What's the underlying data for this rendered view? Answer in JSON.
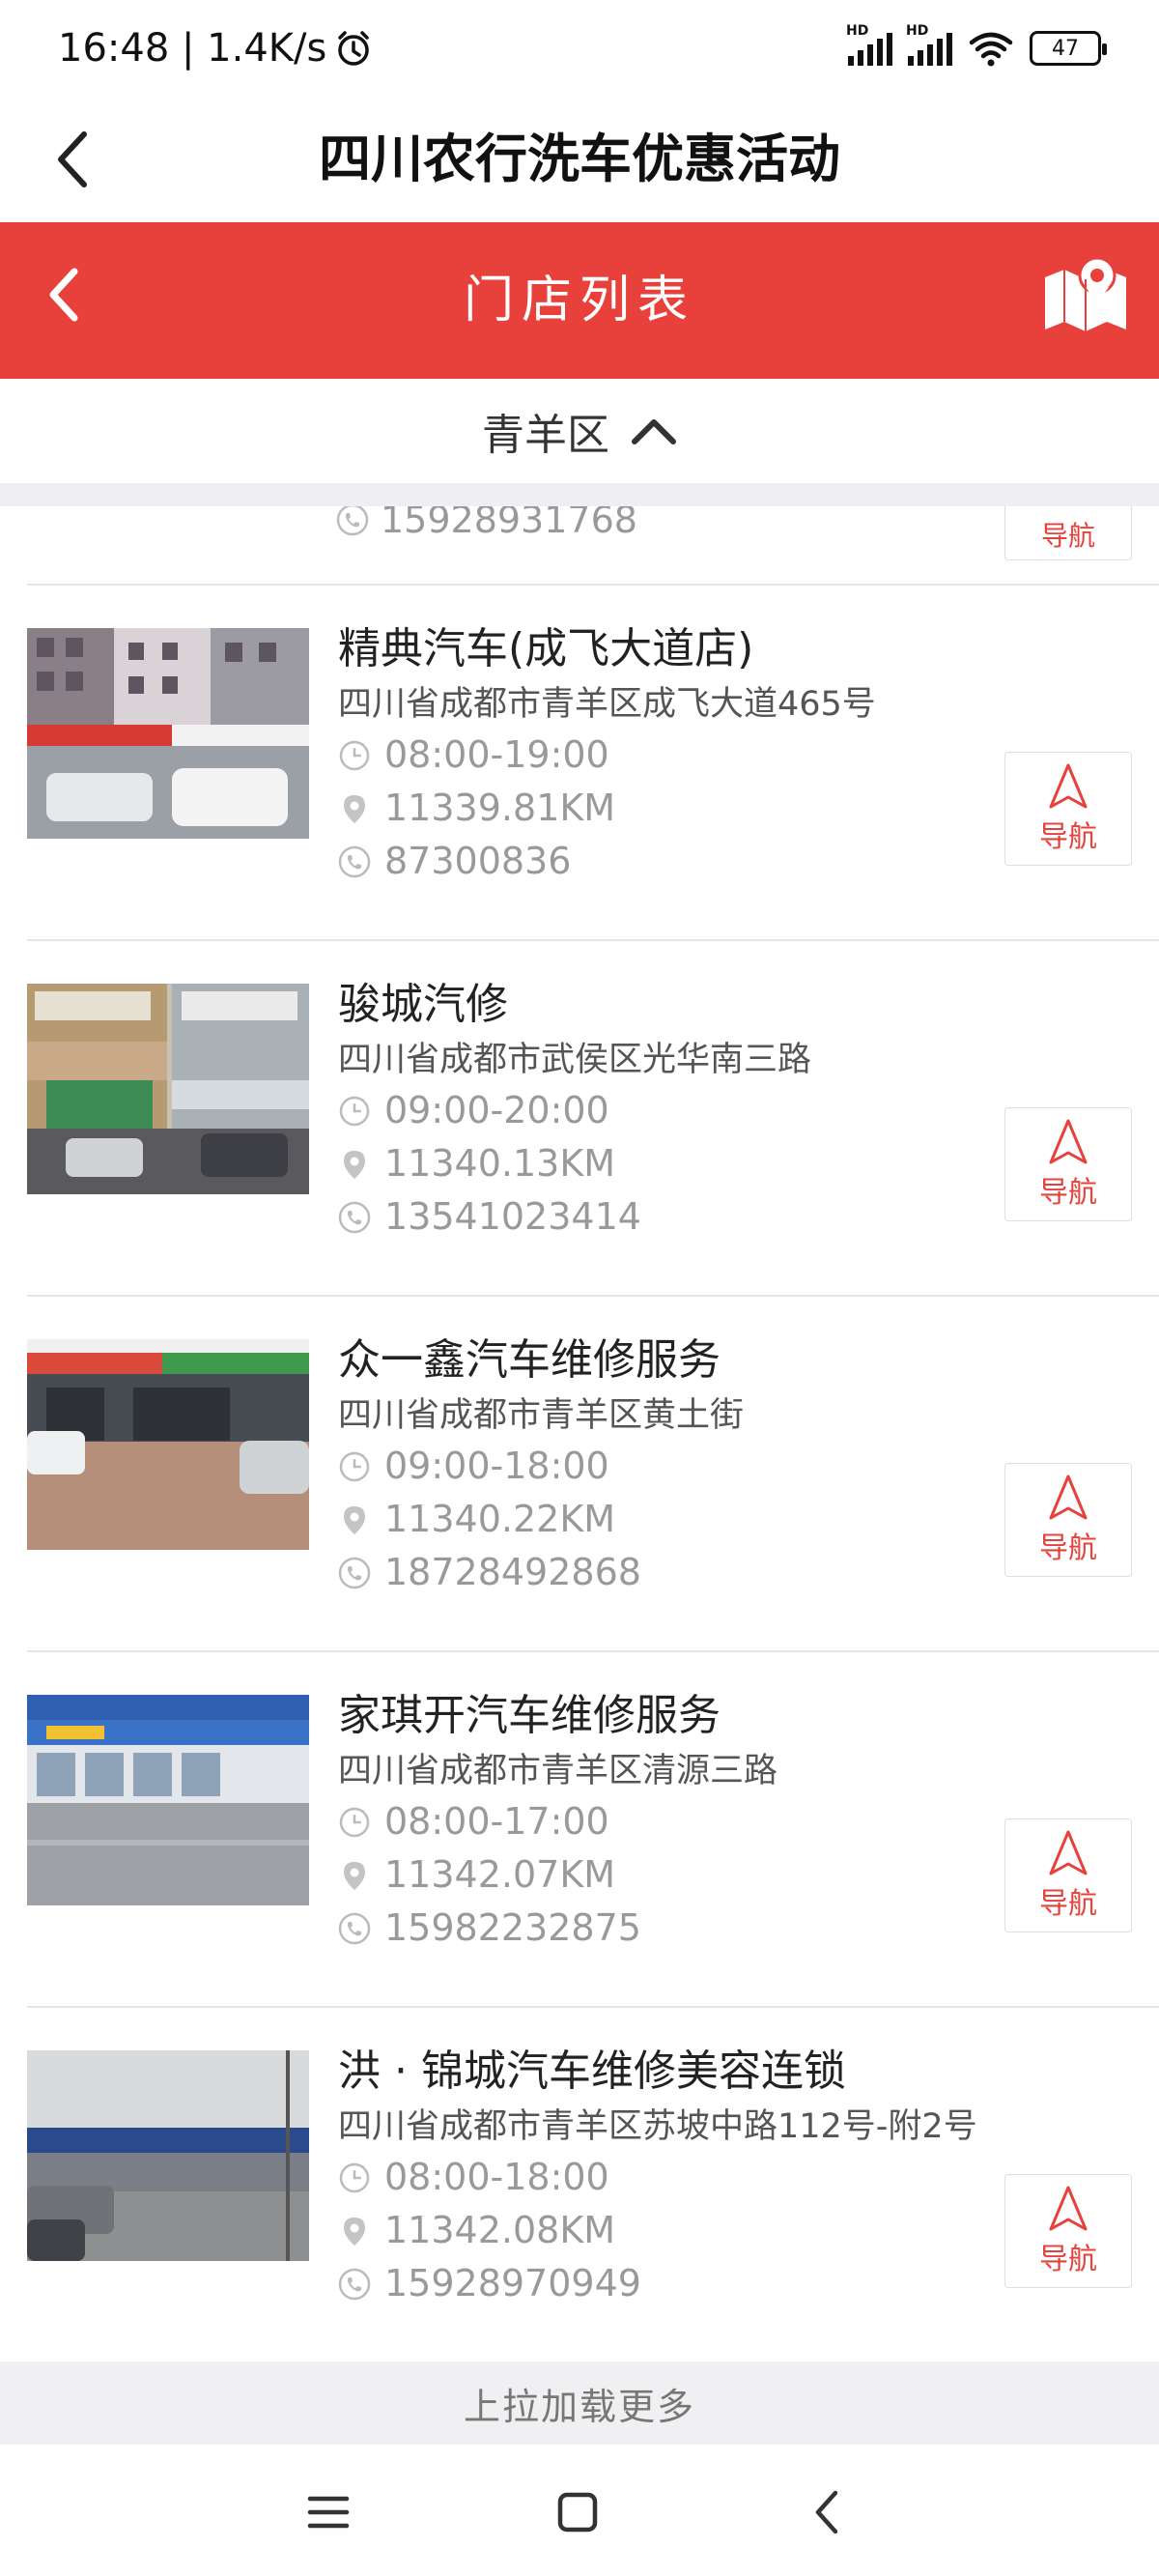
{
  "status_bar": {
    "time": "16:48 | 1.4K/s",
    "battery": "47",
    "hd1": "HD",
    "hd2": "HD"
  },
  "header": {
    "title": "四川农行洗车优惠活动"
  },
  "red_bar": {
    "title": "门店列表"
  },
  "district": {
    "label": "青羊区"
  },
  "partial_item": {
    "phone": "15928931768",
    "nav_label": "导航"
  },
  "stores": [
    {
      "name": "精典汽车(成飞大道店)",
      "address": "四川省成都市青羊区成飞大道465号",
      "hours": "08:00-19:00",
      "distance": "11339.81KM",
      "phone": "87300836",
      "nav_label": "导航"
    },
    {
      "name": "骏城汽修",
      "address": "四川省成都市武侯区光华南三路",
      "hours": "09:00-20:00",
      "distance": "11340.13KM",
      "phone": "13541023414",
      "nav_label": "导航"
    },
    {
      "name": "众一鑫汽车维修服务",
      "address": "四川省成都市青羊区黄土街",
      "hours": "09:00-18:00",
      "distance": "11340.22KM",
      "phone": "18728492868",
      "nav_label": "导航"
    },
    {
      "name": "家琪开汽车维修服务",
      "address": "四川省成都市青羊区清源三路",
      "hours": "08:00-17:00",
      "distance": "11342.07KM",
      "phone": "15982232875",
      "nav_label": "导航"
    },
    {
      "name": "洪 · 锦城汽车维修美容连锁",
      "address": "四川省成都市青羊区苏坡中路112号-附2号",
      "hours": "08:00-18:00",
      "distance": "11342.08KM",
      "phone": "15928970949",
      "nav_label": "导航"
    }
  ],
  "footer": {
    "load_more": "上拉加载更多"
  },
  "colors": {
    "brand_red": "#e8403b"
  }
}
